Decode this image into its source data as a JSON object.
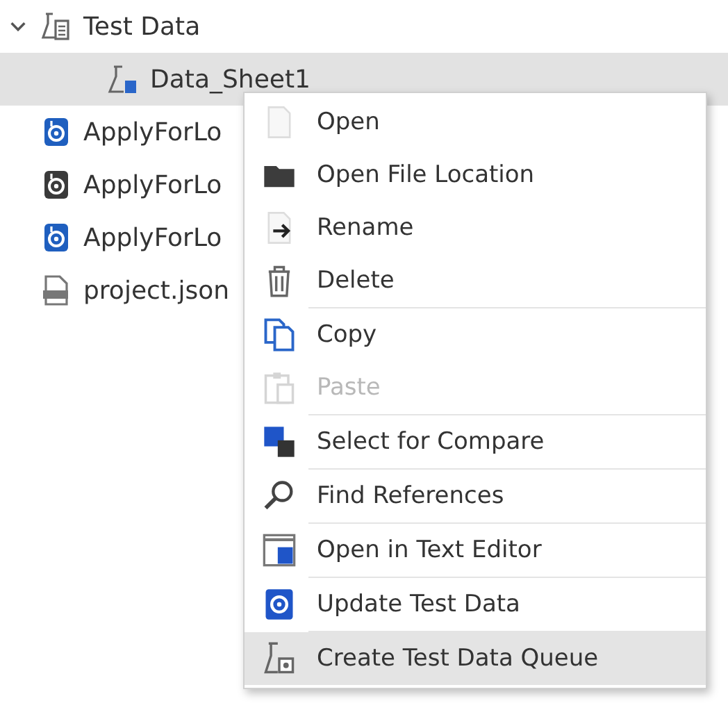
{
  "tree": [
    {
      "label": "Test Data",
      "kind": "testdata",
      "expanded": true,
      "selected": false,
      "children": [
        {
          "label": "Data_Sheet1",
          "kind": "datasheet",
          "selected": true
        }
      ]
    },
    {
      "label": "ApplyForLo",
      "kind": "workflow",
      "color": "#1f5fbf",
      "selected": false
    },
    {
      "label": "ApplyForLo",
      "kind": "workflow",
      "color": "#3a3a3a",
      "selected": false
    },
    {
      "label": "ApplyForLo",
      "kind": "workflow",
      "color": "#1f5fbf",
      "selected": false
    },
    {
      "label": "project.json",
      "kind": "json",
      "selected": false
    }
  ],
  "context_menu": {
    "items": [
      {
        "label": "Open",
        "kind": "open",
        "disabled": false,
        "selected": false,
        "separator_before": false
      },
      {
        "label": "Open File Location",
        "kind": "folder",
        "disabled": false,
        "selected": false,
        "separator_before": false
      },
      {
        "label": "Rename",
        "kind": "rename",
        "disabled": false,
        "selected": false,
        "separator_before": false
      },
      {
        "label": "Delete",
        "kind": "delete",
        "disabled": false,
        "selected": false,
        "separator_before": false
      },
      {
        "label": "Copy",
        "kind": "copy",
        "disabled": false,
        "selected": false,
        "separator_before": true
      },
      {
        "label": "Paste",
        "kind": "paste",
        "disabled": true,
        "selected": false,
        "separator_before": false
      },
      {
        "label": "Select for Compare",
        "kind": "compare",
        "disabled": false,
        "selected": false,
        "separator_before": true
      },
      {
        "label": "Find References",
        "kind": "find",
        "disabled": false,
        "selected": false,
        "separator_before": true
      },
      {
        "label": "Open in Text Editor",
        "kind": "editor",
        "disabled": false,
        "selected": false,
        "separator_before": true
      },
      {
        "label": "Update Test Data",
        "kind": "update",
        "disabled": false,
        "selected": false,
        "separator_before": true
      },
      {
        "label": "Create Test Data Queue",
        "kind": "queue",
        "disabled": false,
        "selected": true,
        "separator_before": true
      }
    ]
  }
}
